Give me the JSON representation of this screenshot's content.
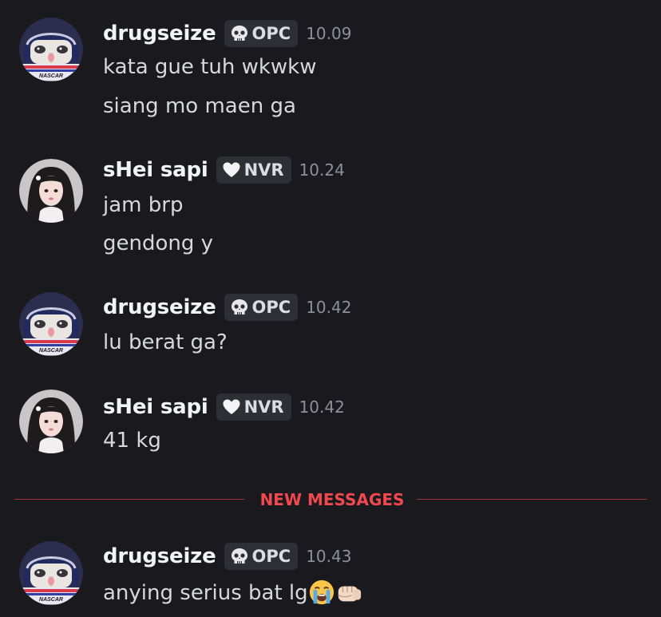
{
  "users": {
    "drugseize": {
      "name": "drugseize",
      "tag_label": "OPC",
      "tag_icon": "skull-icon"
    },
    "shei": {
      "name": "sHei sapi",
      "tag_label": "NVR",
      "tag_icon": "white-heart-icon"
    }
  },
  "messages": [
    {
      "author": "drugseize",
      "tag": "OPC",
      "time": "10.09",
      "lines": [
        "kata gue tuh wkwkw",
        "siang mo maen ga"
      ]
    },
    {
      "author": "sHei sapi",
      "tag": "NVR",
      "time": "10.24",
      "lines": [
        "jam brp",
        "gendong y"
      ]
    },
    {
      "author": "drugseize",
      "tag": "OPC",
      "time": "10.42",
      "lines": [
        "lu berat ga?"
      ]
    },
    {
      "author": "sHei sapi",
      "tag": "NVR",
      "time": "10.42",
      "lines": [
        "41 kg"
      ]
    },
    {
      "author": "drugseize",
      "tag": "OPC",
      "time": "10.43",
      "lines": [
        "anying serius bat lg"
      ],
      "emojis": [
        "loudly-crying-face-icon",
        "oncoming-fist-icon"
      ]
    }
  ],
  "divider": {
    "label": "NEW MESSAGES"
  },
  "colors": {
    "background": "#1a1a1e",
    "username": "#f2f3f5",
    "message_text": "#d7d8dc",
    "timestamp": "#8e9097",
    "tag_background": "#2e2f35",
    "new_messages_accent": "#f0484f",
    "divider_line": "#a0363c"
  }
}
